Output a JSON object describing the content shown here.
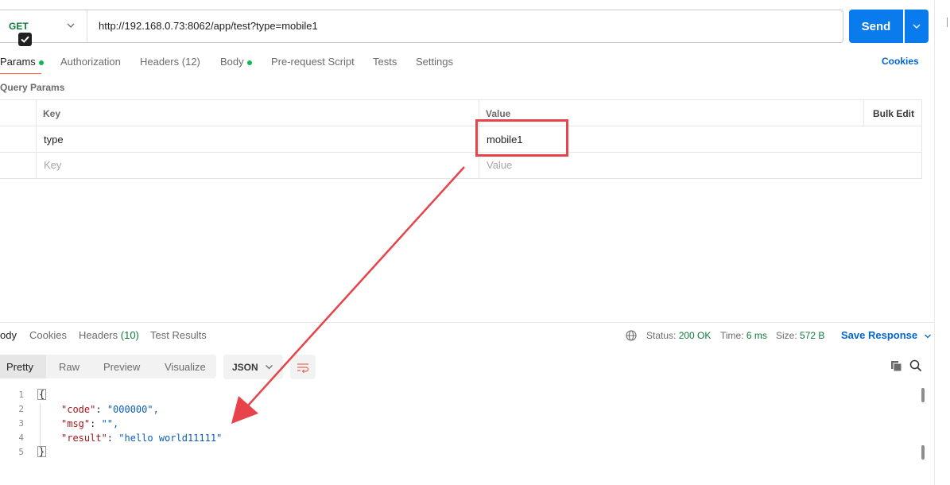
{
  "request": {
    "method": "GET",
    "url": "http://192.168.0.73:8062/app/test?type=mobile1",
    "send_label": "Send"
  },
  "tabs": [
    {
      "label": "Params",
      "active": true,
      "dot": true
    },
    {
      "label": "Authorization"
    },
    {
      "label": "Headers",
      "count": "(12)"
    },
    {
      "label": "Body",
      "dot": true
    },
    {
      "label": "Pre-request Script"
    },
    {
      "label": "Tests"
    },
    {
      "label": "Settings"
    }
  ],
  "cookies_label": "Cookies",
  "query_params": {
    "title": "Query Params",
    "headers": {
      "key": "Key",
      "value": "Value",
      "bulk": "Bulk Edit"
    },
    "rows": [
      {
        "key": "type",
        "value": "mobile1",
        "checked": true
      }
    ],
    "placeholder": {
      "key": "Key",
      "value": "Value"
    }
  },
  "response": {
    "tabs": [
      {
        "label": "ody",
        "active": true
      },
      {
        "label": "Cookies"
      },
      {
        "label": "Headers",
        "count": "(10)"
      },
      {
        "label": "Test Results"
      }
    ],
    "status_label": "Status:",
    "status_value": "200 OK",
    "time_label": "Time:",
    "time_value": "6 ms",
    "size_label": "Size:",
    "size_value": "572 B",
    "save_label": "Save Response",
    "views": [
      "Pretty",
      "Raw",
      "Preview",
      "Visualize"
    ],
    "format": "JSON",
    "body_lines": [
      {
        "n": "1",
        "text": "{"
      },
      {
        "n": "2",
        "key": "\"code\"",
        "value": "\"000000\","
      },
      {
        "n": "3",
        "key": "\"msg\"",
        "value": "\"\","
      },
      {
        "n": "4",
        "key": "\"result\"",
        "value": "\"hello world11111\""
      },
      {
        "n": "5",
        "text": "}"
      }
    ]
  },
  "colors": {
    "accent": "#097bed",
    "method": "#0f7a3b",
    "annotation": "#e8434a",
    "active_tab": "#ff6c37"
  }
}
